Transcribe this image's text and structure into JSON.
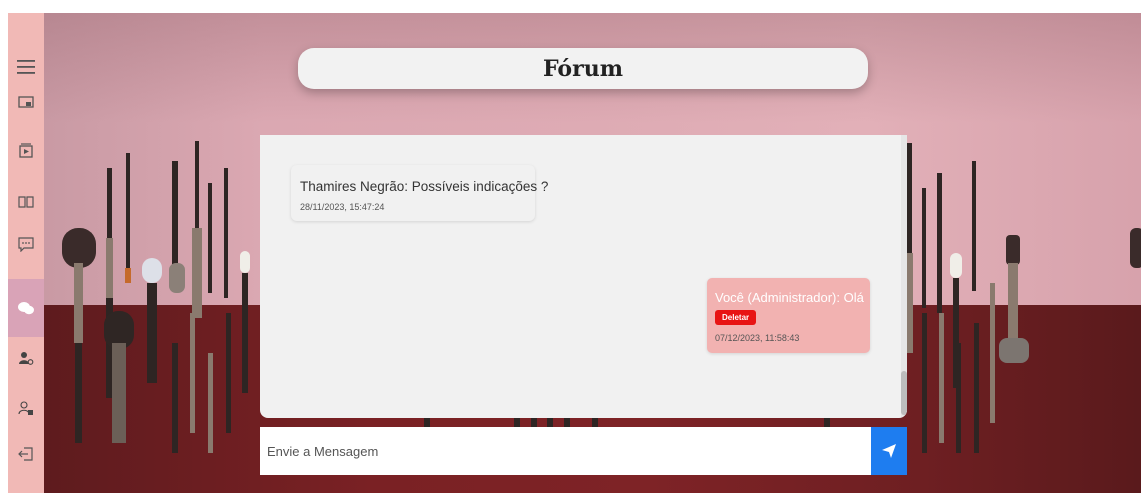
{
  "sidebar": {
    "items": [
      {
        "icon": "menu-icon"
      },
      {
        "icon": "monitor-user-icon"
      },
      {
        "icon": "video-icon"
      },
      {
        "icon": "book-icon"
      },
      {
        "icon": "chat-icon"
      },
      {
        "icon": "forum-icon",
        "active": true
      },
      {
        "icon": "user-settings-icon"
      },
      {
        "icon": "user-lock-icon"
      },
      {
        "icon": "logout-icon"
      }
    ]
  },
  "header": {
    "title": "Fórum"
  },
  "messages": [
    {
      "author_text": "Thamires Negrão: Possíveis indicações ?",
      "timestamp": "28/11/2023, 15:47:24",
      "own": false
    },
    {
      "author_text": "Você (Administrador): Olá",
      "delete_label": "Deletar",
      "timestamp": "07/12/2023, 11:58:43",
      "own": true
    }
  ],
  "composer": {
    "placeholder": "Envie a Mensagem",
    "value": ""
  },
  "colors": {
    "sidebar_bg": "#f1b9b6",
    "sidebar_active": "#d9a3b7",
    "own_message_bg": "#f2b2b1",
    "delete_button": "#e81414",
    "send_button": "#1e7df0"
  }
}
